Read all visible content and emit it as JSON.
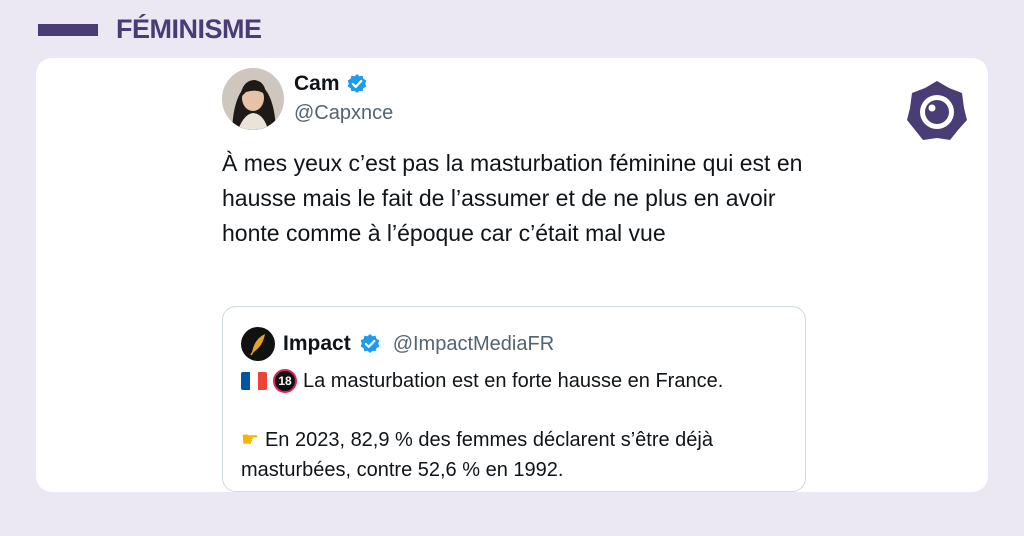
{
  "category": {
    "label": "FÉMINISME"
  },
  "tweet": {
    "author_name": "Cam",
    "author_handle": "@Capxnce",
    "text": "À mes yeux c’est pas la masturbation féminine qui est en hausse mais le fait de l’assumer et de ne plus en avoir honte comme à l’époque car c’était mal vue"
  },
  "quoted_tweet": {
    "author_name": "Impact",
    "author_handle": "@ImpactMediaFR",
    "headline": "La masturbation est en forte hausse en France.",
    "badge": "18",
    "body": "En 2023, 82,9 % des femmes déclarent s’être déjà masturbées, contre 52,6 % en 1992."
  },
  "icons": {
    "verified": "verified-badge-icon",
    "flag": "france-flag-icon",
    "pointer": "pointing-hand-icon",
    "logo": "brand-logo-icon"
  },
  "colors": {
    "background": "#ece8f3",
    "accent": "#4a3c74",
    "verified": "#1d9bf0"
  }
}
